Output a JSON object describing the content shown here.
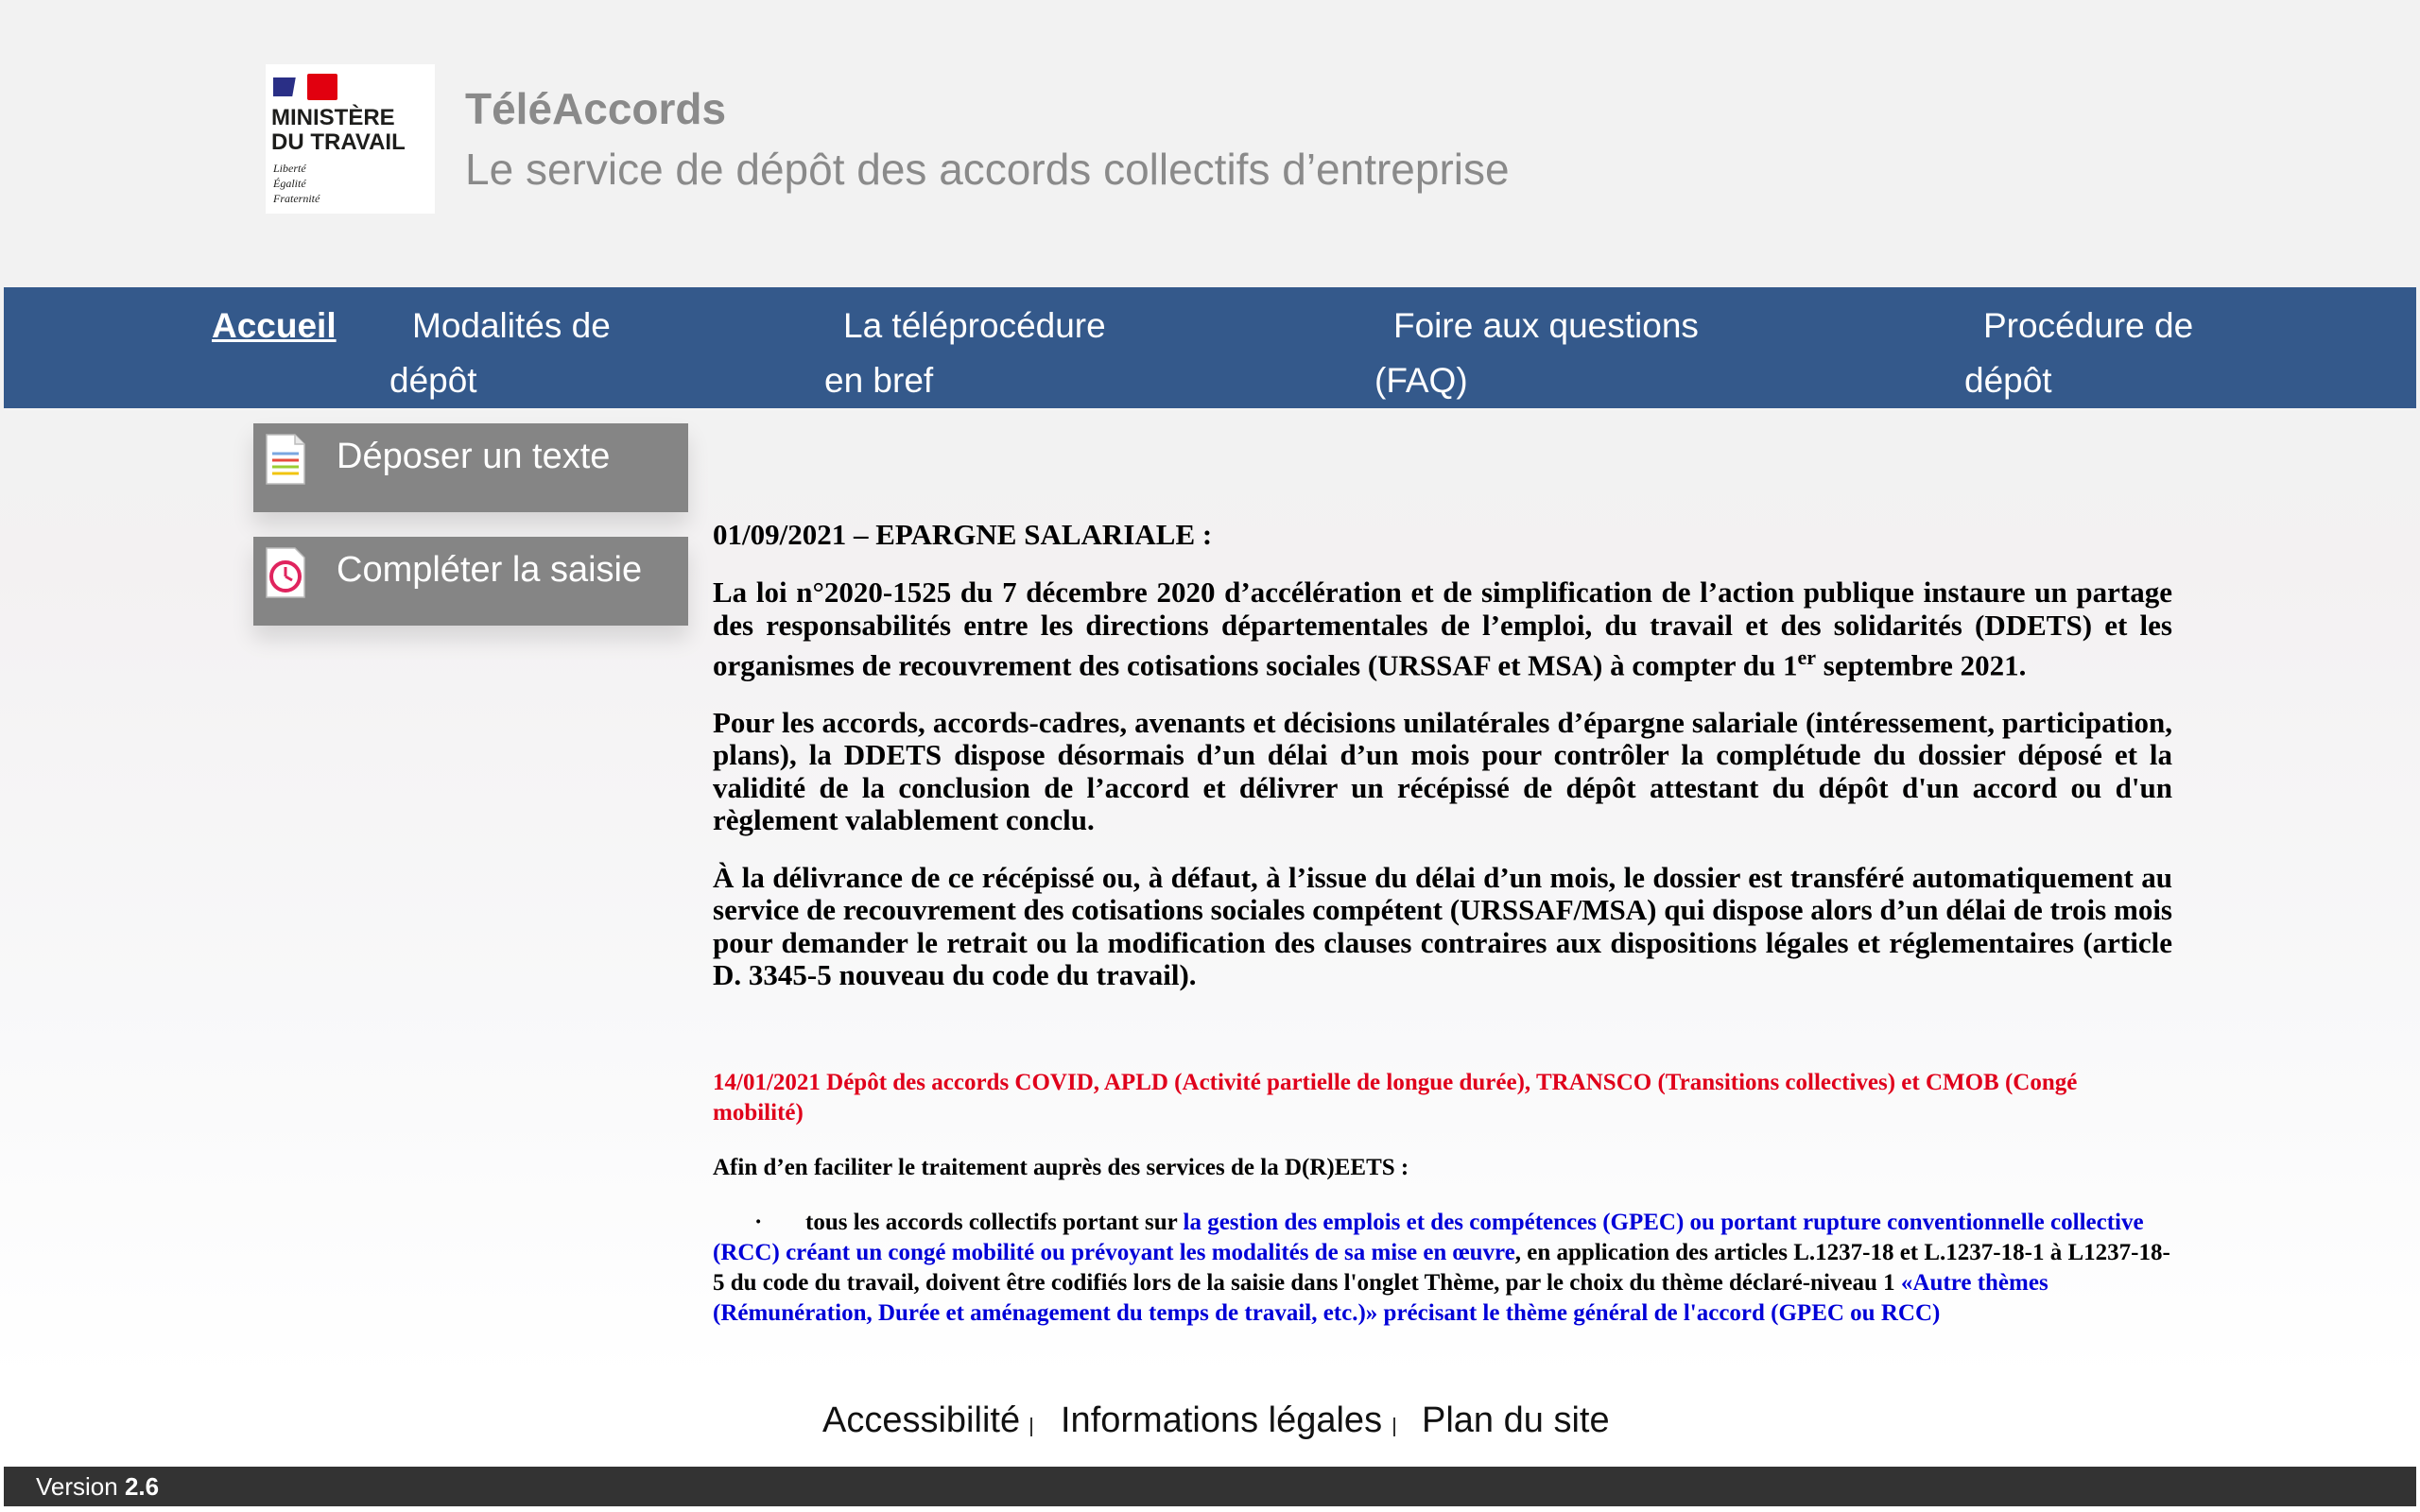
{
  "header": {
    "logo_lines": [
      "MINISTÈRE",
      "DU TRAVAIL"
    ],
    "logo_motto": [
      "Liberté",
      "Égalité",
      "Fraternité"
    ],
    "title": "TéléAccords",
    "tagline": "Le service de dépôt des accords collectifs d’entreprise"
  },
  "nav": {
    "items": [
      {
        "line1": "Accueil",
        "line2": ""
      },
      {
        "line1": "Modalités de",
        "line2": "dépôt"
      },
      {
        "line1": "La téléprocédure",
        "line2": "en bref"
      },
      {
        "line1": "Foire aux questions",
        "line2": "(FAQ)"
      },
      {
        "line1": "Procédure de",
        "line2": "dépôt"
      }
    ]
  },
  "sidebar": {
    "buttons": [
      {
        "label": "Déposer un texte",
        "icon": "document-icon"
      },
      {
        "label": "Compléter la saisie",
        "icon": "clock-icon"
      }
    ]
  },
  "news": {
    "item1": {
      "title": "01/09/2021 – EPARGNE SALARIALE :",
      "p1_a": "La loi n°2020-1525 du 7 décembre 2020 d’accélération et de simplification de l’action publique instaure un partage des responsabilités entre les directions départementales de l’emploi, du travail et des solidarités (DDETS) et les organismes de recouvrement des cotisations sociales (URSSAF et MSA) à compter du 1",
      "p1_sup": "er",
      "p1_b": " septembre 2021.",
      "p2": "Pour les accords, accords-cadres, avenants et décisions unilatérales d’épargne salariale (intéressement, participation, plans), la DDETS dispose désormais d’un délai d’un mois pour contrôler la complétude du dossier déposé et la validité de la conclusion de l’accord et délivrer un récépissé de dépôt attestant du dépôt d'un accord ou d'un règlement valablement conclu.",
      "p3": "À la délivrance de ce récépissé ou, à défaut, à l’issue du délai d’un mois, le dossier est transféré automatiquement au service de recouvrement des cotisations sociales compétent (URSSAF/MSA) qui dispose alors d’un délai de trois mois pour demander le retrait ou la modification des clauses contraires aux dispositions légales et réglementaires (article D. 3345-5 nouveau du code du travail)."
    },
    "item2": {
      "title": "14/01/2021 Dépôt des accords COVID, APLD (Activité partielle de longue durée), TRANSCO (Transitions collectives) et CMOB (Congé mobilité)",
      "intro": "Afin d’en faciliter le traitement auprès des services de la D(R)EETS :",
      "bullet_symbol": "·",
      "bullet_a": "tous les accords collectifs portant sur ",
      "bullet_blue": "la gestion des emplois et des compétences (GPEC) ou portant rupture conventionnelle collective (RCC) créant un congé mobilité ou prévoyant les modalités de sa mise en œuvre",
      "bullet_b": ", en application des articles  L.1237-18 et L.1237-18-1 à L1237-18-5 du code du travail, doivent être codifiés lors de la saisie dans l'onglet Thème, par le choix du thème déclaré-niveau 1",
      "bullet_blue2": "«Autre thèmes (Rémunération, Durée et aménagement du temps de travail, etc.)» précisant le thème général de l'accord (GPEC ou RCC)"
    }
  },
  "footer": {
    "links": [
      "Accessibilité",
      "Informations légales",
      "Plan du site"
    ],
    "version_label": "Version ",
    "version_number": "2.6"
  },
  "colors": {
    "nav_bg": "#34598b",
    "side_button_bg": "#858585",
    "header_text": "#8a8a8a",
    "alert_red": "#e0001b",
    "link_blue": "#0000d8",
    "version_bar": "#333333"
  }
}
